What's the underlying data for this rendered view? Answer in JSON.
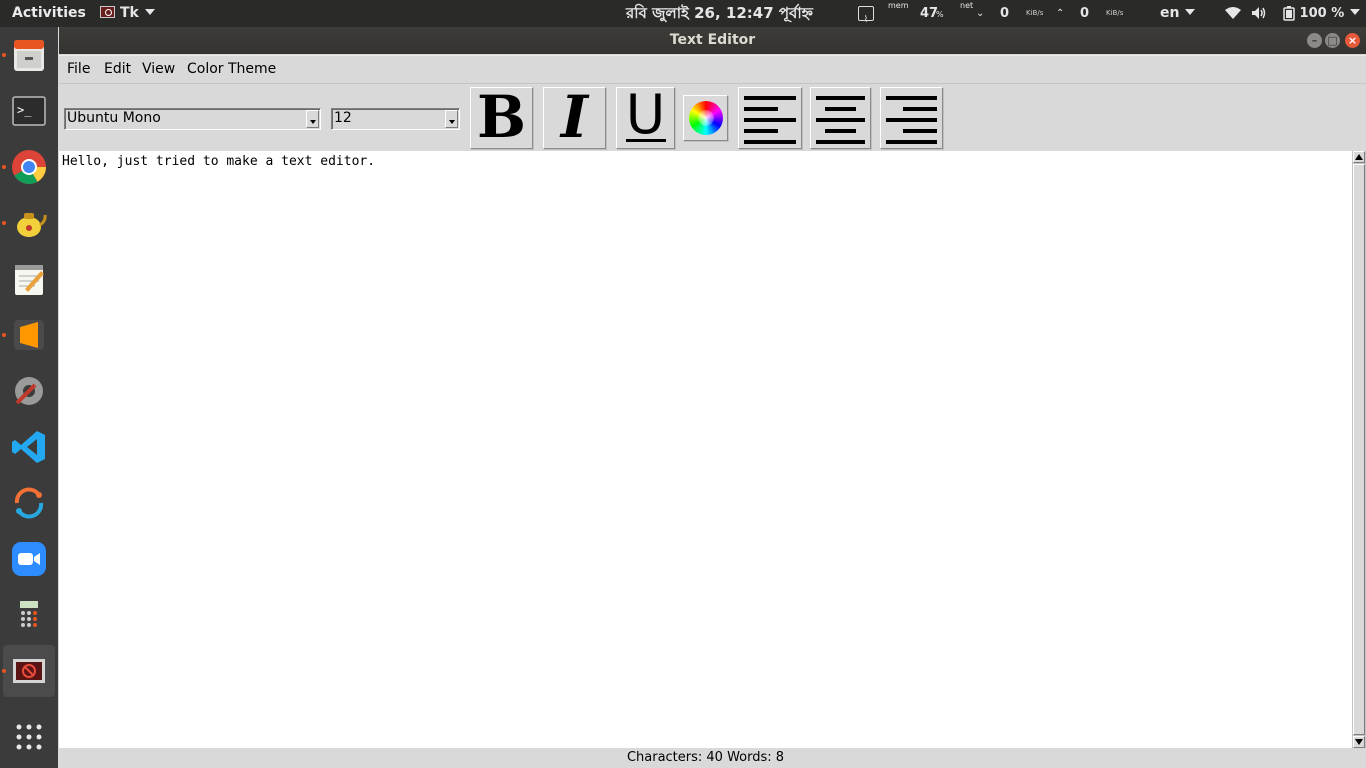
{
  "topbar": {
    "activities": "Activities",
    "app_name": "Tk",
    "clock": "রবি জুলাই 26, 12:47 পূর্বাহ্ন",
    "mem_label": "mem",
    "mem_value": "47",
    "mem_unit": "%",
    "net_label": "net",
    "net_down_value": "0",
    "net_down_unit": "KiB/s",
    "net_up_value": "0",
    "net_up_unit": "KiB/s",
    "language": "en",
    "battery": "100 %"
  },
  "dock": {
    "items": [
      {
        "name": "file-manager",
        "running": true
      },
      {
        "name": "terminal",
        "running": false
      },
      {
        "name": "chrome",
        "running": true
      },
      {
        "name": "teapot-app",
        "running": true
      },
      {
        "name": "text-editor-gedit",
        "running": false
      },
      {
        "name": "sublime-text",
        "running": true
      },
      {
        "name": "system-settings",
        "running": false
      },
      {
        "name": "vscode",
        "running": false
      },
      {
        "name": "postman",
        "running": false
      },
      {
        "name": "zoom",
        "running": false
      },
      {
        "name": "calculator",
        "running": false
      },
      {
        "name": "tk-window",
        "running": true
      },
      {
        "name": "show-applications",
        "running": false
      }
    ]
  },
  "window": {
    "title": "Text Editor",
    "menu": [
      "File",
      "Edit",
      "View",
      "Color Theme"
    ],
    "font_family": "Ubuntu Mono",
    "font_size": "12",
    "toolbar": {
      "bold": "B",
      "italic": "I",
      "underline": "U"
    },
    "editor_text": "Hello, just tried to make a text editor.",
    "status": "Characters: 40 Words: 8"
  }
}
